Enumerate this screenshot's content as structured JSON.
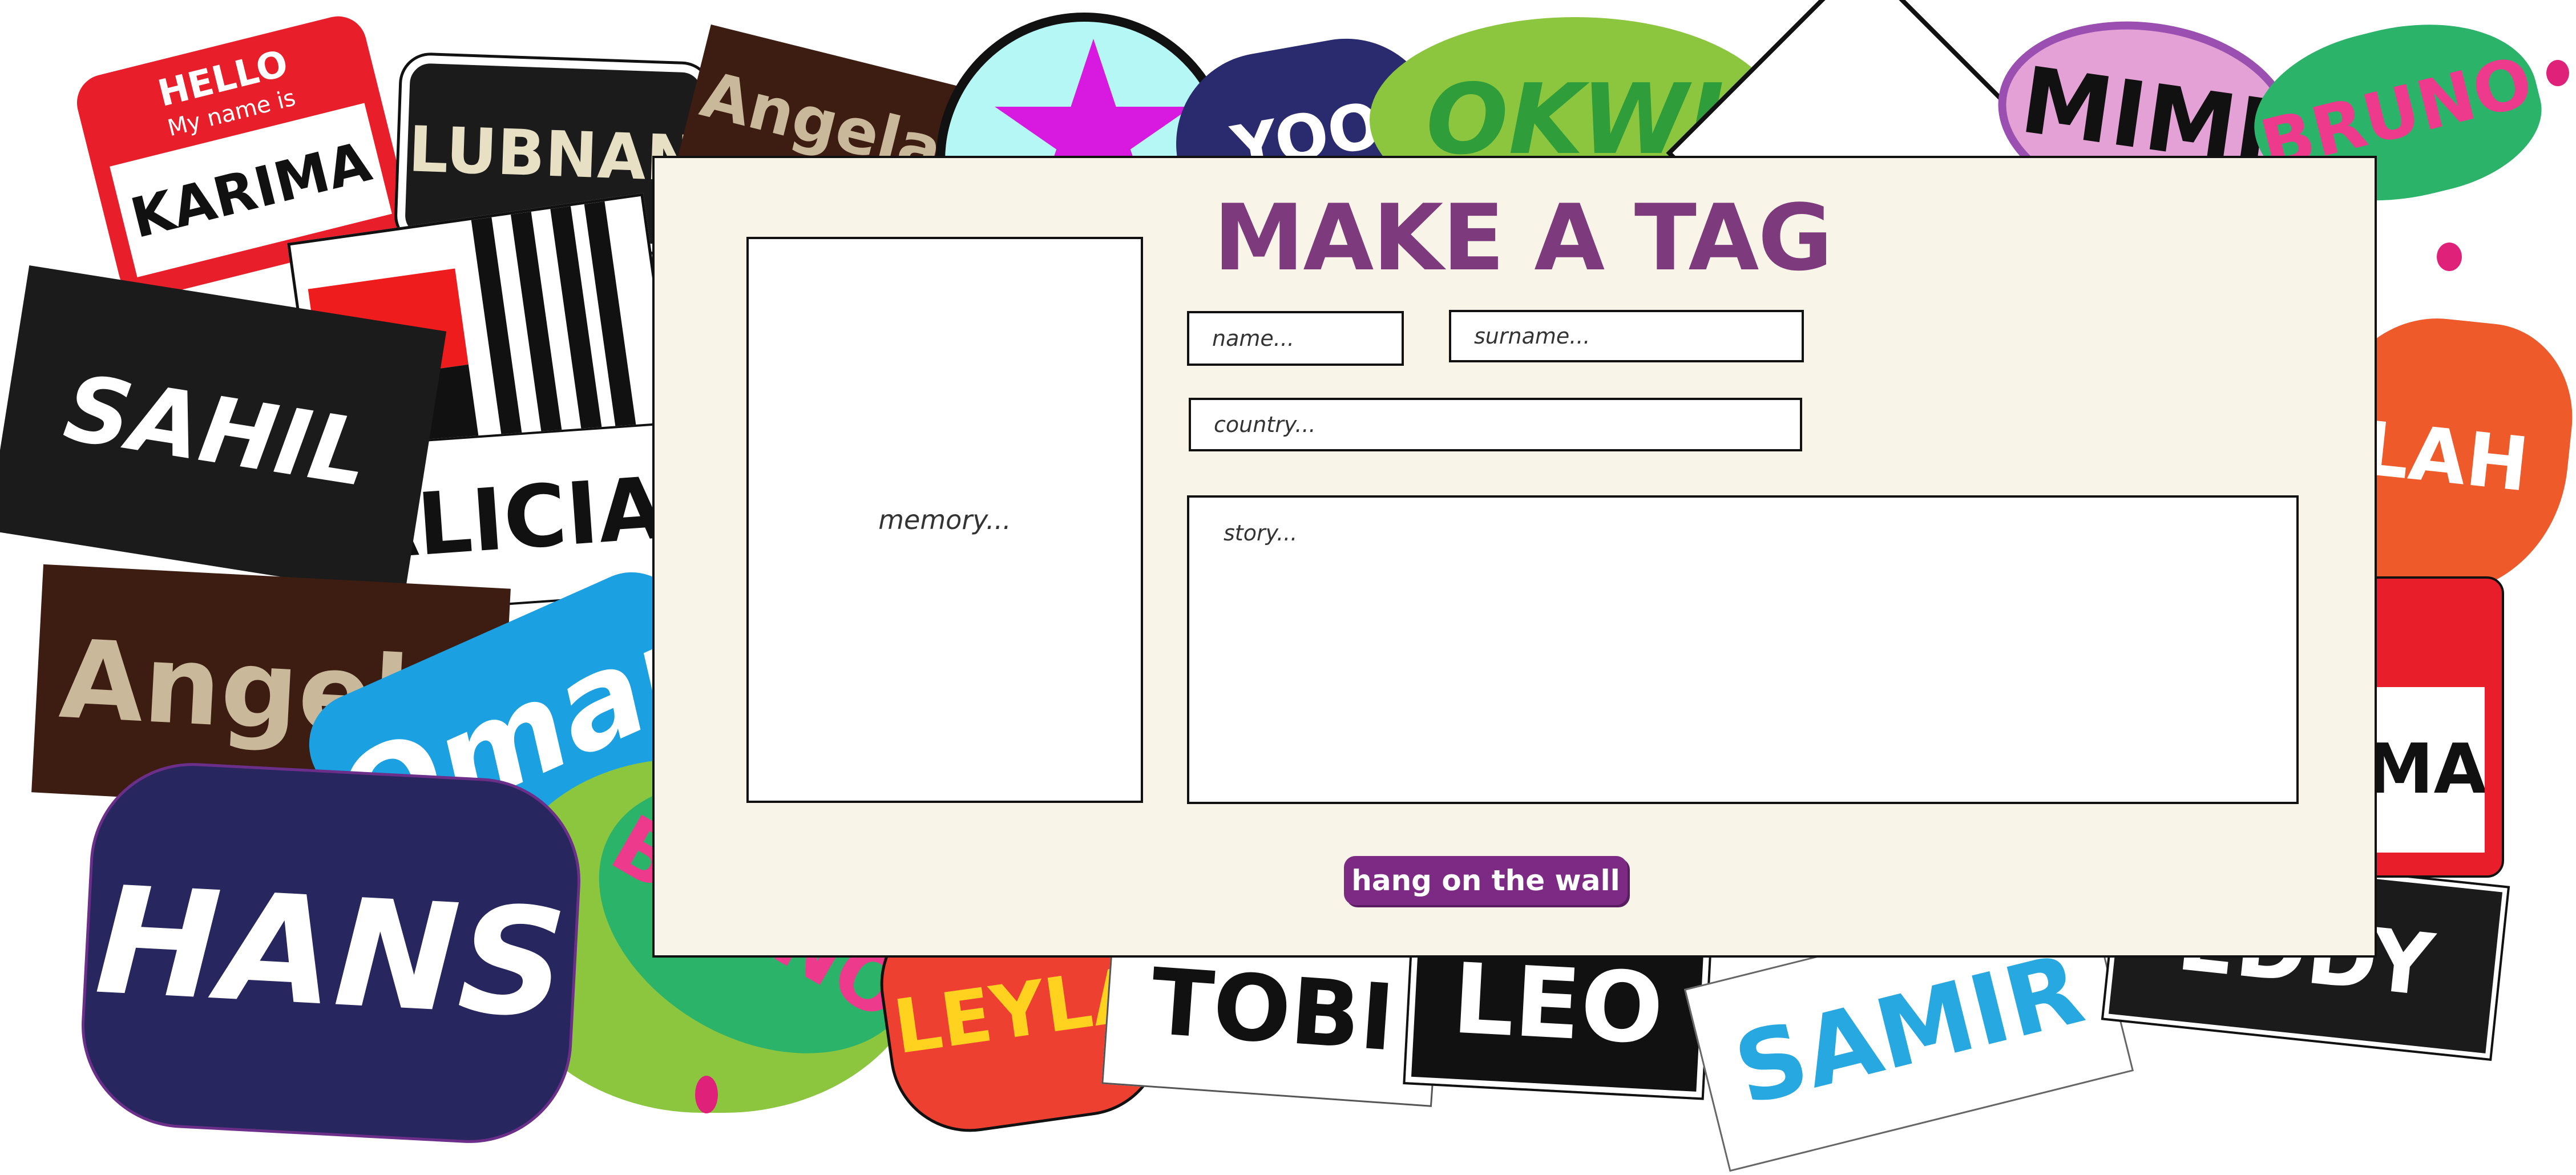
{
  "form": {
    "title": "MAKE A TAG",
    "memory_label": "memory...",
    "name_placeholder": "name...",
    "surname_placeholder": "surname...",
    "country_placeholder": "country...",
    "story_placeholder": "story...",
    "submit_label": "hang on the wall"
  },
  "wall": {
    "hello_sticker": {
      "header": "HELLO",
      "subheader": "My name is",
      "name": "KARIMA"
    },
    "tags": [
      "LUBNAN",
      "Angela",
      "SAHIL",
      "ALICIA",
      "Angela",
      "Omar",
      "HANS",
      "BRUNO",
      "LEYLA",
      "TOBI",
      "LEO",
      "SAMIR",
      "OKWI",
      "MIMI",
      "BRUNO",
      "LAH",
      "IMA",
      "EDDY",
      "YOO"
    ]
  },
  "colors": {
    "title": "#7d3a7c",
    "button": "#7d2a85",
    "card_background": "#f8f4e7",
    "field_border": "#111111"
  }
}
